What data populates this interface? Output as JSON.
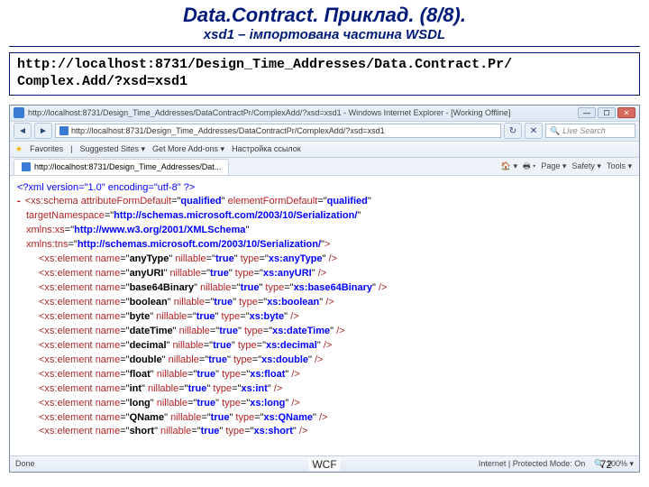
{
  "header": {
    "title": "Data.Contract. Приклад.  (8/8).",
    "subtitle_prefix": "xsd",
    "subtitle_num": "1 – імпортована частина ",
    "subtitle_suffix": "WSDL"
  },
  "urlbox": {
    "line1": "http://localhost:8731/Design_Time_Addresses/Data.Contract.Pr/",
    "line2": "Complex.Add/?xsd=xsd1"
  },
  "browser": {
    "window_title": "http://localhost:8731/Design_Time_Addresses/DataContractPr/ComplexAdd/?xsd=xsd1 - Windows Internet Explorer - [Working Offline]",
    "address": "http://localhost:8731/Design_Time_Addresses/DataContractPr/ComplexAdd/?xsd=xsd1",
    "search_placeholder": "Live Search",
    "fav_label": "Favorites",
    "fav_items": [
      "Suggested Sites ▾",
      "Get More Add-ons ▾",
      "Настройка ссылок"
    ],
    "tab_label": "http://localhost:8731/Design_Time_Addresses/Dat...",
    "tab_tools": [
      "🏠 ▾",
      "🖶 ▾",
      "Page ▾",
      "Safety ▾",
      "Tools ▾"
    ],
    "status_left": "Done",
    "status_right": [
      "Internet | Protected Mode: On",
      "🔍 100% ▾"
    ]
  },
  "xml": {
    "decl": "<?xml version=\"1.0\" encoding=\"utf-8\" ?>",
    "schema_open1": "<xs:schema attributeFormDefault=\"",
    "qualified": "qualified",
    "schema_open2": "\" elementFormDefault=\"",
    "schema_open3": "\"",
    "tns_label": "targetNamespace=\"",
    "tns_val": "http://schemas.microsoft.com/2003/10/Serialization/",
    "xmlns_xs_label": "xmlns:xs=\"",
    "xmlns_xs_val": "http://www.w3.org/2001/XMLSchema",
    "xmlns_tns_label": "xmlns:tns=\"",
    "xmlns_tns_val": "http://schemas.microsoft.com/2003/10/Serialization/",
    "close_schema_attrs": "\">",
    "elements": [
      {
        "name": "anyType",
        "type": "xs:anyType"
      },
      {
        "name": "anyURI",
        "type": "xs:anyURI"
      },
      {
        "name": "base64Binary",
        "type": "xs:base64Binary"
      },
      {
        "name": "boolean",
        "type": "xs:boolean"
      },
      {
        "name": "byte",
        "type": "xs:byte"
      },
      {
        "name": "dateTime",
        "type": "xs:dateTime"
      },
      {
        "name": "decimal",
        "type": "xs:decimal"
      },
      {
        "name": "double",
        "type": "xs:double"
      },
      {
        "name": "float",
        "type": "xs:float"
      },
      {
        "name": "int",
        "type": "xs:int"
      },
      {
        "name": "long",
        "type": "xs:long"
      },
      {
        "name": "QName",
        "type": "xs:QName"
      },
      {
        "name": "short",
        "type": "xs:short"
      }
    ],
    "nillable": "true"
  },
  "footer": {
    "label": "WCF",
    "page": "72"
  }
}
